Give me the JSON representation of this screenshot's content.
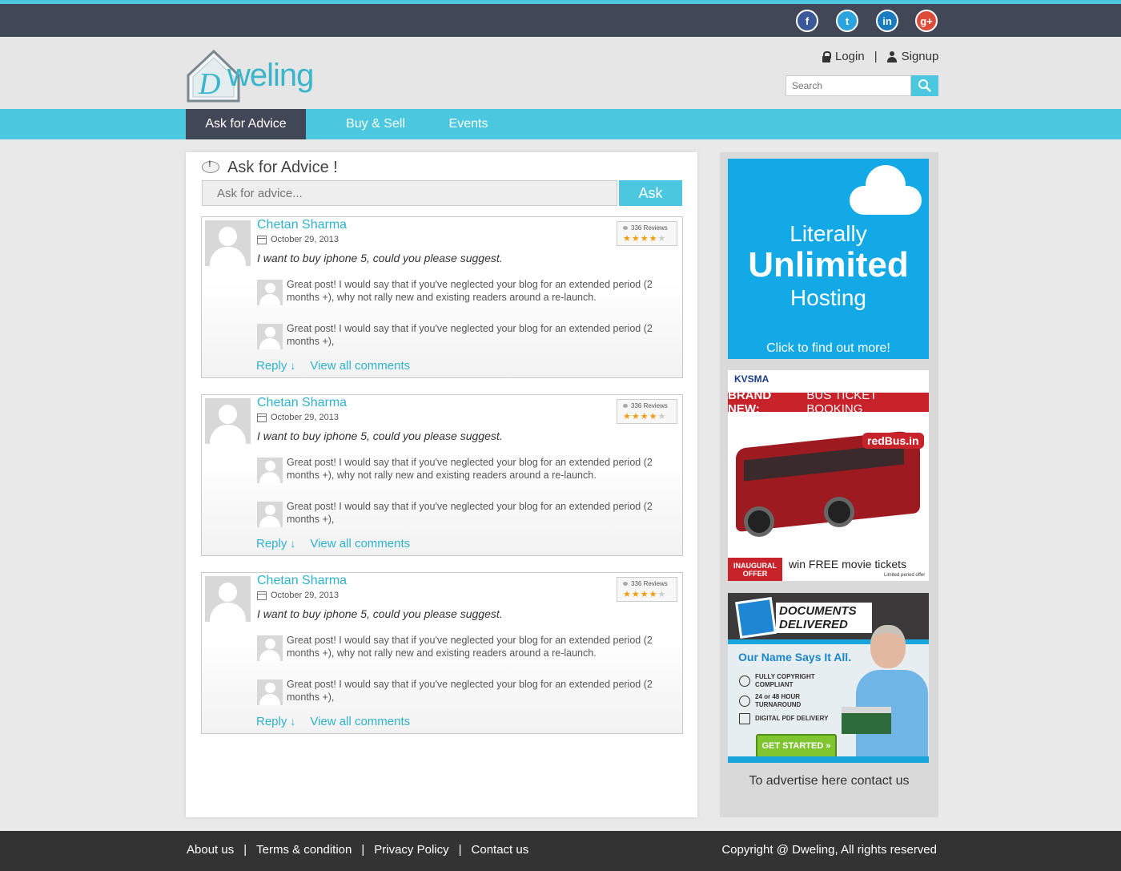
{
  "social": [
    "f",
    "t",
    "in",
    "g+"
  ],
  "header": {
    "logo_text": "weling",
    "logo_letter": "D",
    "login": "Login",
    "signup": "Signup",
    "separator": "|",
    "search_placeholder": "Search"
  },
  "nav": {
    "items": [
      {
        "label": "Ask for Advice"
      },
      {
        "label": "Buy & Sell"
      },
      {
        "label": "Events"
      }
    ]
  },
  "ask": {
    "title": "Ask for Advice !",
    "placeholder": "Ask for advice...",
    "button": "Ask"
  },
  "posts": [
    {
      "author": "Chetan Sharma",
      "date": "October 29, 2013",
      "question": "I want to buy iphone 5, could you please suggest.",
      "reviews": "336 Reviews",
      "rating": 4,
      "comments": [
        "Great post! I would say that if you've neglected your blog for an extended period (2 months +), why not rally new and existing readers around a re-launch.",
        "Great post! I would say that if you've neglected your blog for an extended period (2 months +),"
      ],
      "reply": "Reply",
      "view_all": "View all comments"
    },
    {
      "author": "Chetan Sharma",
      "date": "October 29, 2013",
      "question": "I want to buy iphone 5, could you please suggest.",
      "reviews": "336 Reviews",
      "rating": 4,
      "comments": [
        "Great post! I would say that if you've neglected your blog for an extended period (2 months +), why not rally new and existing readers around a re-launch.",
        "Great post! I would say that if you've neglected your blog for an extended period (2 months +),"
      ],
      "reply": "Reply",
      "view_all": "View all comments"
    },
    {
      "author": "Chetan Sharma",
      "date": "October 29, 2013",
      "question": "I want to buy iphone 5, could you please suggest.",
      "reviews": "336 Reviews",
      "rating": 4,
      "comments": [
        "Great post! I would say that if you've neglected your blog for an extended period (2 months +), why not rally new and existing readers around a re-launch.",
        "Great post! I would say that if you've neglected your blog for an extended period (2 months +),"
      ],
      "reply": "Reply",
      "view_all": "View all comments"
    }
  ],
  "ads": {
    "hosting": {
      "line1": "Literally",
      "line2": "Unlimited",
      "line3": "Hosting",
      "cta": "Click to find out more!"
    },
    "bus": {
      "brand": "KVSMA",
      "banner_bold": "BRAND NEW:",
      "banner_text": "BUS TICKET BOOKING",
      "redbus": "redBus.in",
      "inaugural": "INAUGURAL OFFER",
      "movie": "win FREE movie tickets",
      "limited": "Limited period offer"
    },
    "docs": {
      "title": "DOCUMENTS DELIVERED",
      "tagline": "Our Name Says It All.",
      "features": [
        "FULLY COPYRIGHT COMPLIANT",
        "24 or 48 HOUR TURNAROUND",
        "DIGITAL PDF DELIVERY"
      ],
      "cta": "GET STARTED »"
    },
    "contact": "To advertise here contact us"
  },
  "footer": {
    "links": [
      "About us",
      "Terms & condition",
      "Privacy Policy",
      "Contact us"
    ],
    "separator": "|",
    "copyright": "Copyright @ Dweling, All rights reserved"
  },
  "colors": {
    "accent": "#4bc7e0",
    "dark": "#414756",
    "link": "#2fb3cd",
    "star": "#f39c12"
  }
}
